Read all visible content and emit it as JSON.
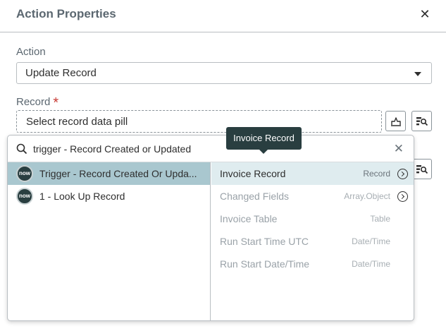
{
  "header": {
    "title": "Action Properties"
  },
  "action": {
    "label": "Action",
    "value": "Update Record"
  },
  "record": {
    "label": "Record",
    "required_mark": "*",
    "pill_placeholder": "Select record data pill"
  },
  "picker": {
    "search_text": "trigger - Record Created or Updated",
    "left_items": [
      {
        "badge": "now",
        "label": "Trigger - Record Created Or Upda...",
        "selected": true
      },
      {
        "badge": "now",
        "label": "1 - Look Up Record",
        "selected": false
      }
    ],
    "right_items": [
      {
        "name": "Invoice Record",
        "type": "Record",
        "drill": true,
        "enabled": true
      },
      {
        "name": "Changed Fields",
        "type": "Array.Object",
        "drill": true,
        "enabled": false
      },
      {
        "name": "Invoice Table",
        "type": "Table",
        "drill": false,
        "enabled": false
      },
      {
        "name": "Run Start Time UTC",
        "type": "Date/Time",
        "drill": false,
        "enabled": false
      },
      {
        "name": "Run Start Date/Time",
        "type": "Date/Time",
        "drill": false,
        "enabled": false
      }
    ]
  },
  "tooltip": {
    "text": "Invoice Record"
  },
  "colors": {
    "selected_left": "#a9c7cf",
    "selected_right": "#dfecef",
    "tooltip_bg": "#293e40",
    "required": "#c83c36"
  },
  "icons": {
    "close": "close-icon",
    "search": "search-icon",
    "clear": "clear-icon",
    "drill": "chevron-right-circle-icon",
    "script": "script-toggle-icon",
    "pill_picker": "data-pill-picker-icon",
    "badge": "servicenow-logo-icon"
  }
}
